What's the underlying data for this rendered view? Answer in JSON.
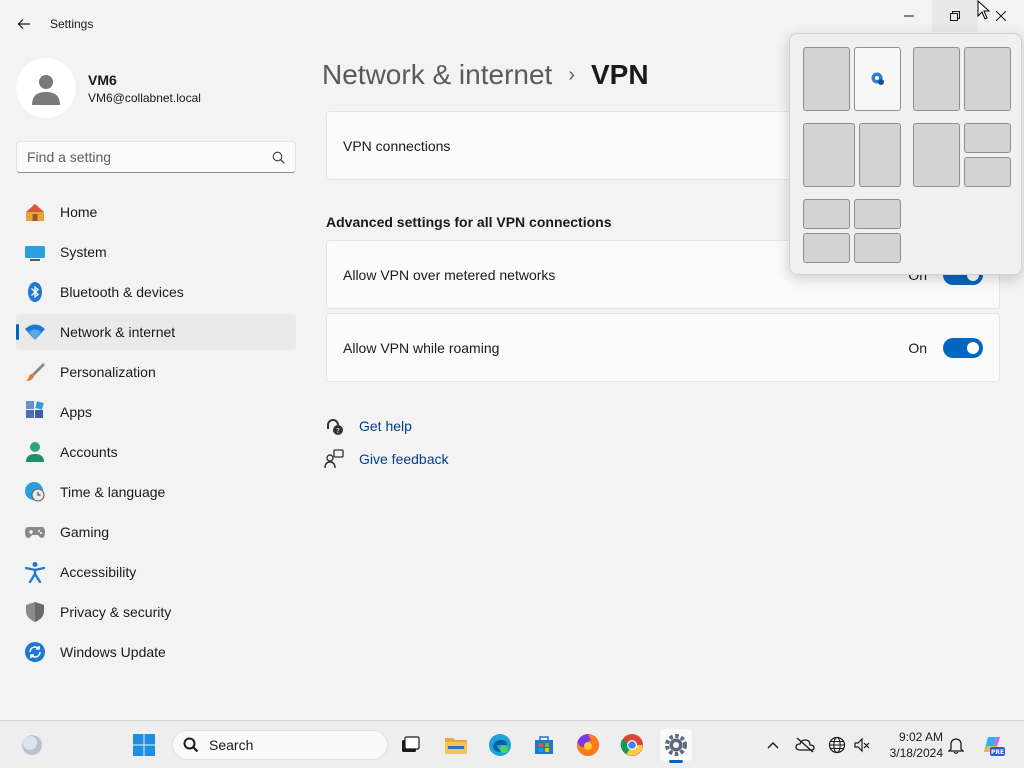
{
  "window": {
    "title": "Settings"
  },
  "profile": {
    "name": "VM6",
    "email": "VM6@collabnet.local"
  },
  "search": {
    "placeholder": "Find a setting"
  },
  "sidebar": {
    "items": [
      {
        "label": "Home",
        "icon": "home-icon"
      },
      {
        "label": "System",
        "icon": "system-icon"
      },
      {
        "label": "Bluetooth & devices",
        "icon": "bluetooth-icon"
      },
      {
        "label": "Network & internet",
        "icon": "wifi-icon",
        "active": true
      },
      {
        "label": "Personalization",
        "icon": "brush-icon"
      },
      {
        "label": "Apps",
        "icon": "apps-icon"
      },
      {
        "label": "Accounts",
        "icon": "accounts-icon"
      },
      {
        "label": "Time & language",
        "icon": "globe-clock-icon"
      },
      {
        "label": "Gaming",
        "icon": "gamepad-icon"
      },
      {
        "label": "Accessibility",
        "icon": "accessibility-icon"
      },
      {
        "label": "Privacy & security",
        "icon": "shield-icon"
      },
      {
        "label": "Windows Update",
        "icon": "update-icon"
      }
    ]
  },
  "breadcrumb": {
    "parent": "Network & internet",
    "separator": "›",
    "current": "VPN"
  },
  "main": {
    "vpn_connections_label": "VPN connections",
    "advanced_heading": "Advanced settings for all VPN connections",
    "settings": [
      {
        "label": "Allow VPN over metered networks",
        "state": "On",
        "enabled": true
      },
      {
        "label": "Allow VPN while roaming",
        "state": "On",
        "enabled": true
      }
    ],
    "help": {
      "get_help": "Get help",
      "give_feedback": "Give feedback"
    }
  },
  "taskbar": {
    "search_label": "Search",
    "time": "9:02 AM",
    "date": "3/18/2024",
    "copilot_badge": "PRE"
  },
  "colors": {
    "accent": "#0067c0",
    "link": "#003e92",
    "background": "#f3f3f3",
    "card": "#fbfbfb"
  }
}
